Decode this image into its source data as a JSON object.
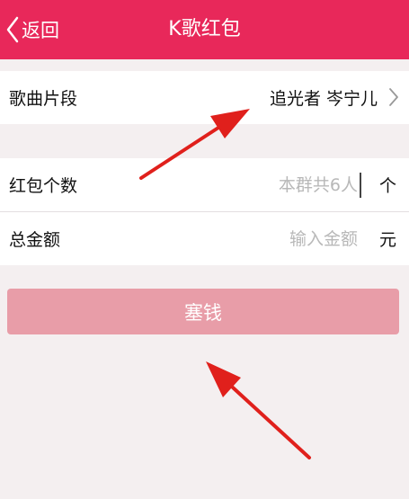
{
  "navbar": {
    "back_label": "返回",
    "title": "K歌红包",
    "color": "#e8285a"
  },
  "song": {
    "label": "歌曲片段",
    "value": "追光者 岑宁儿"
  },
  "count": {
    "label": "红包个数",
    "placeholder": "本群共6人",
    "unit": "个"
  },
  "amount": {
    "label": "总金额",
    "placeholder": "输入金额",
    "unit": "元"
  },
  "submit_label": "塞钱",
  "colors": {
    "submit_disabled": "#e89da8",
    "annotation_arrow": "#e0201c"
  },
  "icons": {
    "back": "chevron-left-icon",
    "song_disclosure": "chevron-right-icon"
  }
}
